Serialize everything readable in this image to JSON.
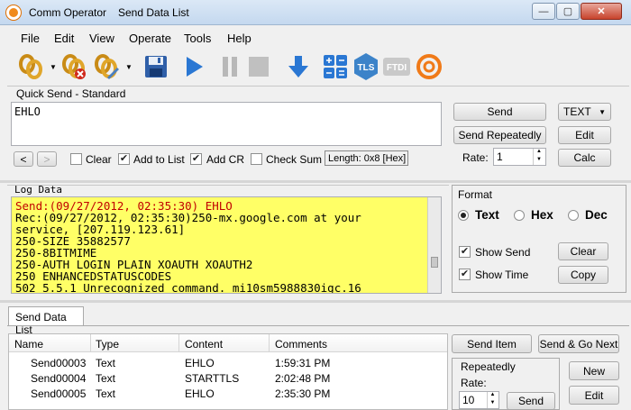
{
  "window": {
    "app_title": "Comm Operator",
    "doc_title": "Send Data List",
    "min_label": "—",
    "max_label": "▢",
    "close_label": "✕"
  },
  "menu": [
    "File",
    "Edit",
    "View",
    "Operate",
    "Tools",
    "Help"
  ],
  "toolbar": {
    "icons": [
      "connect-icon",
      "connect-dropdown-icon",
      "disconnect-icon",
      "edit-connection-icon",
      "edit-dropdown-icon",
      "save-icon",
      "play-icon",
      "pause-icon",
      "stop-icon",
      "download-icon",
      "calculator-icon",
      "tls-icon",
      "ftdi-icon",
      "app-logo-icon"
    ],
    "tls_label": "TLS",
    "ftdi_label": "FTDI"
  },
  "quick_send": {
    "caption": "Quick Send - Standard",
    "text": "EHLO",
    "send_label": "Send",
    "send_repeatedly_label": "Send Repeatedly",
    "rate_label": "Rate:",
    "rate_value": "1",
    "mode_value": "TEXT",
    "edit_label": "Edit",
    "calc_label": "Calc",
    "prev_label": "<",
    "next_label": ">",
    "clear_label": "Clear",
    "add_to_list_label": "Add to List",
    "add_cr_label": "Add CR",
    "check_sum_label": "Check Sum",
    "length_label": "Length: 0x8 [Hex]",
    "clear_checked": false,
    "add_to_list_checked": true,
    "add_cr_checked": true,
    "check_sum_checked": false
  },
  "log": {
    "caption": "Log Data",
    "lines": [
      {
        "text": "Send:(09/27/2012, 02:35:30) EHLO",
        "kind": "send"
      },
      {
        "text": "Rec:(09/27/2012, 02:35:30)250-mx.google.com at your",
        "kind": "rec"
      },
      {
        "text": "service, [207.119.123.61]",
        "kind": "rec"
      },
      {
        "text": "250-SIZE 35882577",
        "kind": "rec"
      },
      {
        "text": "250-8BITMIME",
        "kind": "rec"
      },
      {
        "text": "250-AUTH LOGIN PLAIN XOAUTH XOAUTH2",
        "kind": "rec"
      },
      {
        "text": "250 ENHANCEDSTATUSCODES",
        "kind": "rec"
      },
      {
        "text": "502 5.5.1 Unrecognized command. mi10sm5988830igc.16",
        "kind": "rec"
      }
    ]
  },
  "format": {
    "caption": "Format",
    "options": [
      "Text",
      "Hex",
      "Dec"
    ],
    "selected": "Text",
    "show_send_label": "Show Send",
    "show_time_label": "Show Time",
    "show_send_checked": true,
    "show_time_checked": true,
    "clear_label": "Clear",
    "copy_label": "Copy"
  },
  "send_list": {
    "tab_label": "Send Data List",
    "columns": [
      "Name",
      "Type",
      "Content",
      "Comments"
    ],
    "rows": [
      {
        "name": "Send00003",
        "type": "Text",
        "content": "EHLO",
        "comments": "1:59:31 PM"
      },
      {
        "name": "Send00004",
        "type": "Text",
        "content": "STARTTLS",
        "comments": "2:02:48 PM"
      },
      {
        "name": "Send00005",
        "type": "Text",
        "content": "EHLO",
        "comments": "2:35:30 PM"
      }
    ],
    "send_item_label": "Send Item",
    "send_go_next_label": "Send & Go Next",
    "repeatedly_caption": "Repeatedly",
    "rate_label": "Rate:",
    "rate_value": "10",
    "send_label": "Send",
    "new_label": "New",
    "edit_label": "Edit"
  }
}
